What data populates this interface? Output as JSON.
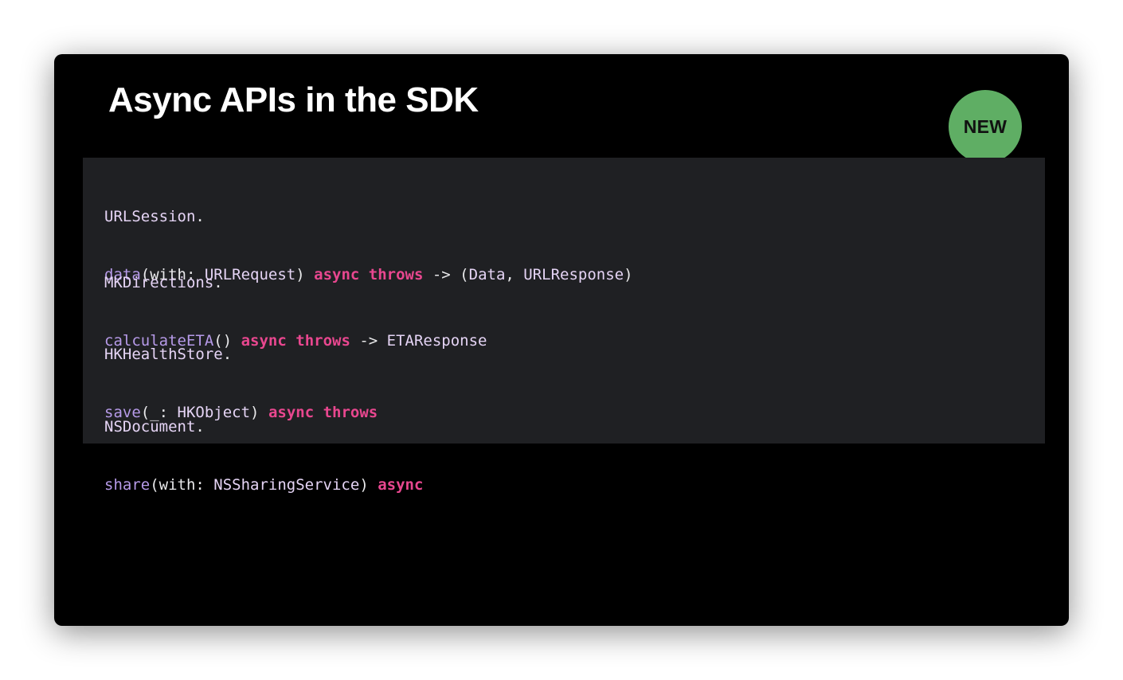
{
  "slide": {
    "title": "Async APIs in the SDK",
    "badge": "NEW"
  },
  "colors": {
    "background": "#000000",
    "code_panel": "#1f2023",
    "keyword": "#e8478f",
    "method": "#b69ae8",
    "type": "#e5d4f5",
    "badge": "#5fae64"
  },
  "code": [
    {
      "line1": [
        {
          "text": "URLSession",
          "kind": "type"
        },
        {
          "text": ".",
          "kind": "plain"
        }
      ],
      "line2": [
        {
          "text": "data",
          "kind": "method"
        },
        {
          "text": "(with: ",
          "kind": "plain"
        },
        {
          "text": "URLRequest",
          "kind": "type"
        },
        {
          "text": ") ",
          "kind": "plain"
        },
        {
          "text": "async",
          "kind": "kw"
        },
        {
          "text": " ",
          "kind": "plain"
        },
        {
          "text": "throws",
          "kind": "kw"
        },
        {
          "text": " -> (",
          "kind": "plain"
        },
        {
          "text": "Data",
          "kind": "type"
        },
        {
          "text": ", ",
          "kind": "plain"
        },
        {
          "text": "URLResponse",
          "kind": "type"
        },
        {
          "text": ")",
          "kind": "plain"
        }
      ]
    },
    {
      "line1": [
        {
          "text": "MKDirections",
          "kind": "type"
        },
        {
          "text": ".",
          "kind": "plain"
        }
      ],
      "line2": [
        {
          "text": "calculateETA",
          "kind": "method"
        },
        {
          "text": "() ",
          "kind": "plain"
        },
        {
          "text": "async",
          "kind": "kw"
        },
        {
          "text": " ",
          "kind": "plain"
        },
        {
          "text": "throws",
          "kind": "kw"
        },
        {
          "text": " -> ",
          "kind": "plain"
        },
        {
          "text": "ETAResponse",
          "kind": "type"
        }
      ]
    },
    {
      "line1": [
        {
          "text": "HKHealthStore",
          "kind": "type"
        },
        {
          "text": ".",
          "kind": "plain"
        }
      ],
      "line2": [
        {
          "text": "save",
          "kind": "method"
        },
        {
          "text": "(_: ",
          "kind": "plain"
        },
        {
          "text": "HKObject",
          "kind": "type"
        },
        {
          "text": ") ",
          "kind": "plain"
        },
        {
          "text": "async",
          "kind": "kw"
        },
        {
          "text": " ",
          "kind": "plain"
        },
        {
          "text": "throws",
          "kind": "kw"
        }
      ]
    },
    {
      "line1": [
        {
          "text": "NSDocument",
          "kind": "type"
        },
        {
          "text": ".",
          "kind": "plain"
        }
      ],
      "line2": [
        {
          "text": "share",
          "kind": "method"
        },
        {
          "text": "(with: ",
          "kind": "plain"
        },
        {
          "text": "NSSharingService",
          "kind": "type"
        },
        {
          "text": ") ",
          "kind": "plain"
        },
        {
          "text": "async",
          "kind": "kw"
        }
      ]
    }
  ]
}
